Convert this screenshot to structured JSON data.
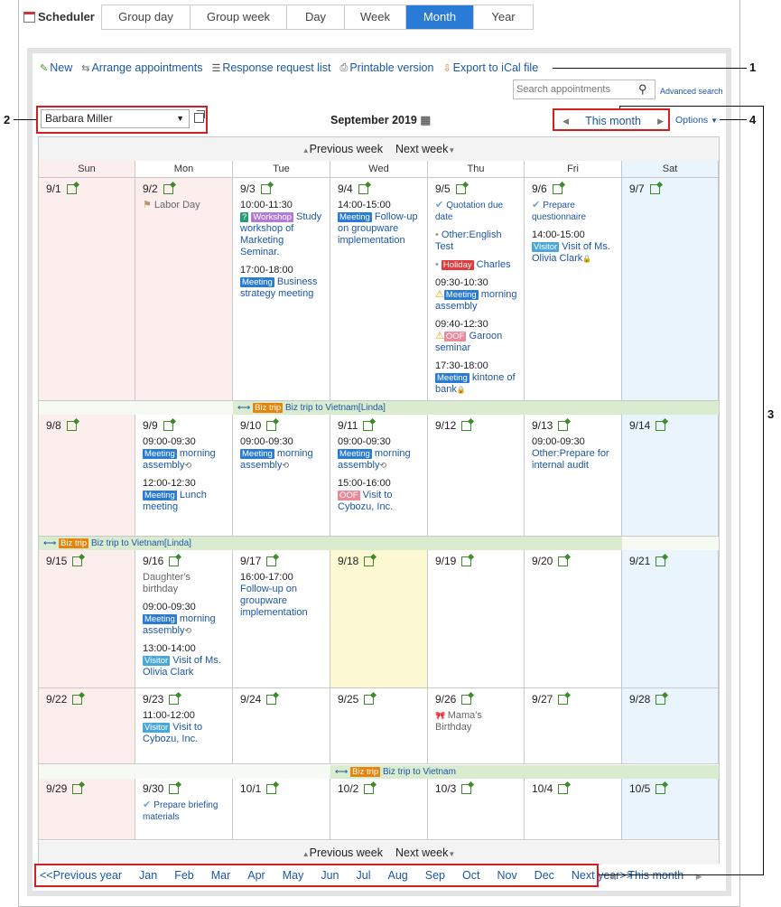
{
  "app": {
    "title": "Scheduler",
    "icon": "calendar-icon"
  },
  "tabs": [
    {
      "label": "Group day"
    },
    {
      "label": "Group week"
    },
    {
      "label": "Day"
    },
    {
      "label": "Week"
    },
    {
      "label": "Month",
      "active": true
    },
    {
      "label": "Year"
    }
  ],
  "toolbar": {
    "new": "New",
    "arrange": "Arrange appointments",
    "response": "Response request list",
    "printable": "Printable version",
    "export": "Export to iCal file"
  },
  "search": {
    "placeholder": "Search appointments",
    "advanced": "Advanced search"
  },
  "user": {
    "selected": "Barbara Miller"
  },
  "month": {
    "label": "September 2019",
    "this_month": "This month",
    "options": "Options"
  },
  "weeknav": {
    "prev": "Previous week",
    "next": "Next week"
  },
  "weekdays": [
    "Sun",
    "Mon",
    "Tue",
    "Wed",
    "Thu",
    "Fri",
    "Sat"
  ],
  "callouts": [
    "1",
    "2",
    "3",
    "4"
  ],
  "weeks": [
    {
      "days": [
        {
          "date": "9/1",
          "events": []
        },
        {
          "date": "9/2",
          "events": [
            {
              "holiday": "Labor Day"
            }
          ]
        },
        {
          "date": "9/3",
          "events": [
            {
              "time": "10:00-11:30",
              "tags": [
                {
                  "t": "?",
                  "c": "#2a9a7a"
                },
                {
                  "t": "Workshop",
                  "c": "#b07ad6"
                }
              ],
              "title": "Study workshop of Marketing Seminar."
            },
            {
              "time": "17:00-18:00",
              "tags": [
                {
                  "t": "Meeting",
                  "c": "#2a7bd6"
                }
              ],
              "title": "Business strategy meeting"
            }
          ]
        },
        {
          "date": "9/4",
          "events": [
            {
              "time": "14:00-15:00",
              "tags": [
                {
                  "t": "Meeting",
                  "c": "#2a7bd6"
                }
              ],
              "title": "Follow-up on groupware implementation"
            }
          ]
        },
        {
          "date": "9/5",
          "events": [
            {
              "todo": "Quotation due date"
            },
            {
              "note": "Other:English Test"
            },
            {
              "tags": [
                {
                  "t": "Holiday",
                  "c": "#e23a3a"
                }
              ],
              "title": "Charles"
            },
            {
              "time": "09:30-10:30",
              "warn": true,
              "tags": [
                {
                  "t": "Meeting",
                  "c": "#2a7bd6"
                }
              ],
              "title": "morning assembly"
            },
            {
              "time": "09:40-12:30",
              "warn": true,
              "tags": [
                {
                  "t": "OOF",
                  "c": "#e88a9a"
                }
              ],
              "title": "Garoon seminar"
            },
            {
              "time": "17:30-18:00",
              "tags": [
                {
                  "t": "Meeting",
                  "c": "#2a7bd6"
                }
              ],
              "title": "kintone of bank",
              "lock": true
            }
          ]
        },
        {
          "date": "9/6",
          "events": [
            {
              "todo": "Prepare questionnaire"
            },
            {
              "time": "14:00-15:00",
              "tags": [
                {
                  "t": "Visitor",
                  "c": "#4aa8d8"
                }
              ],
              "title": "Visit of Ms. Olivia Clark",
              "lock": true
            }
          ]
        },
        {
          "date": "9/7",
          "events": []
        }
      ]
    },
    {
      "days": [
        {
          "date": "9/8",
          "events": []
        },
        {
          "date": "9/9",
          "events": [
            {
              "time": "09:00-09:30",
              "tags": [
                {
                  "t": "Meeting",
                  "c": "#2a7bd6"
                }
              ],
              "title": "morning assembly",
              "repeat": true
            },
            {
              "time": "12:00-12:30",
              "tags": [
                {
                  "t": "Meeting",
                  "c": "#2a7bd6"
                }
              ],
              "title": "Lunch meeting"
            }
          ]
        },
        {
          "date": "9/10",
          "events": [
            {
              "time": "09:00-09:30",
              "tags": [
                {
                  "t": "Meeting",
                  "c": "#2a7bd6"
                }
              ],
              "title": "morning assembly",
              "repeat": true
            }
          ]
        },
        {
          "date": "9/11",
          "events": [
            {
              "time": "09:00-09:30",
              "tags": [
                {
                  "t": "Meeting",
                  "c": "#2a7bd6"
                }
              ],
              "title": "morning assembly",
              "repeat": true
            },
            {
              "time": "15:00-16:00",
              "tags": [
                {
                  "t": "OOF",
                  "c": "#e88a9a"
                }
              ],
              "title": "Visit to Cybozu, Inc."
            }
          ]
        },
        {
          "date": "9/12",
          "events": []
        },
        {
          "date": "9/13",
          "events": [
            {
              "time": "09:00-09:30",
              "title": "Other:Prepare for internal audit"
            }
          ]
        },
        {
          "date": "9/14",
          "events": []
        }
      ]
    },
    {
      "days": [
        {
          "date": "9/15",
          "events": []
        },
        {
          "date": "9/16",
          "events": [
            {
              "gray": "Daughter's birthday"
            },
            {
              "time": "09:00-09:30",
              "tags": [
                {
                  "t": "Meeting",
                  "c": "#2a7bd6"
                }
              ],
              "title": "morning assembly",
              "repeat": true
            },
            {
              "time": "13:00-14:00",
              "tags": [
                {
                  "t": "Visitor",
                  "c": "#4aa8d8"
                }
              ],
              "title": "Visit of Ms. Olivia Clark"
            }
          ]
        },
        {
          "date": "9/17",
          "events": [
            {
              "time": "16:00-17:00",
              "title": "Follow-up on groupware implementation"
            }
          ]
        },
        {
          "date": "9/18",
          "events": []
        },
        {
          "date": "9/19",
          "events": []
        },
        {
          "date": "9/20",
          "events": []
        },
        {
          "date": "9/21",
          "events": []
        }
      ]
    },
    {
      "days": [
        {
          "date": "9/22",
          "events": []
        },
        {
          "date": "9/23",
          "events": [
            {
              "time": "11:00-12:00",
              "tags": [
                {
                  "t": "Visitor",
                  "c": "#4aa8d8"
                }
              ],
              "title": "Visit to Cybozu, Inc."
            }
          ]
        },
        {
          "date": "9/24",
          "events": []
        },
        {
          "date": "9/25",
          "events": []
        },
        {
          "date": "9/26",
          "events": [
            {
              "birthday": "Mama's Birthday"
            }
          ]
        },
        {
          "date": "9/27",
          "events": []
        },
        {
          "date": "9/28",
          "events": []
        }
      ]
    },
    {
      "days": [
        {
          "date": "9/29",
          "events": []
        },
        {
          "date": "9/30",
          "events": [
            {
              "todo": "Prepare briefing materials"
            }
          ]
        },
        {
          "date": "10/1",
          "events": []
        },
        {
          "date": "10/2",
          "events": []
        },
        {
          "date": "10/3",
          "events": []
        },
        {
          "date": "10/4",
          "events": []
        },
        {
          "date": "10/5",
          "events": []
        }
      ]
    }
  ],
  "bands": [
    {
      "label": "Biz trip",
      "text": "Biz trip to Vietnam[Linda]"
    },
    {
      "label": "Biz trip",
      "text": "Biz trip to Vietnam[Linda]"
    },
    {
      "label": "Biz trip",
      "text": "Biz trip to Vietnam"
    }
  ],
  "bottomnav": {
    "prev_year": "<<Previous year",
    "months": [
      "Jan",
      "Feb",
      "Mar",
      "Apr",
      "May",
      "Jun",
      "Jul",
      "Aug",
      "Sep",
      "Oct",
      "Nov",
      "Dec"
    ],
    "next_year": "Next year>>",
    "this_month": "This month"
  },
  "colors": {
    "accent": "#2a7bd6",
    "sun_bg": "#fdeeee",
    "sat_bg": "#e9f4fd",
    "today_bg": "#fbf8d2",
    "holiday_bg": "#fdeeee",
    "callout": "#d21f1f"
  }
}
